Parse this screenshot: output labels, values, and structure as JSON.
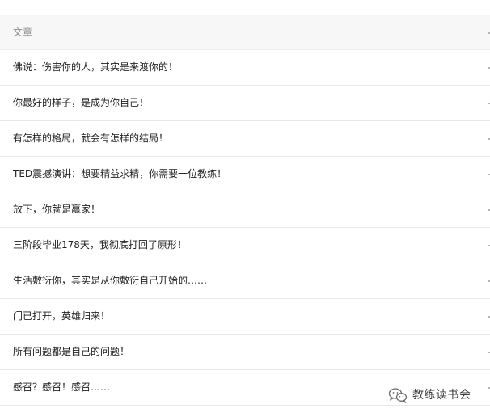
{
  "table": {
    "column_header": "文章",
    "articles": [
      "佛说：伤害你的人，其实是来渡你的！",
      "你最好的样子，是成为你自己！",
      "有怎样的格局，就会有怎样的结局！",
      "TED震撼演讲：想要精益求精，你需要一位教练！",
      "放下，你就是赢家！",
      "三阶段毕业178天，我彻底打回了原形！",
      "生活敷衍你，其实是从你敷衍自己开始的……",
      "门已打开，英雄归来！",
      "所有问题都是自己的问题！",
      "感召？感召！感召……"
    ]
  },
  "watermark": {
    "icon": "wechat-icon",
    "text": "教练读书会"
  },
  "colors": {
    "header_background": "#f7f7f8",
    "header_text": "#8f8f8f",
    "row_text": "#222222",
    "divider": "#e8e8e8"
  }
}
